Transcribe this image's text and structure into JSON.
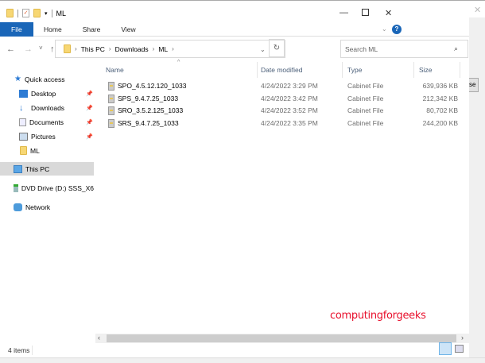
{
  "window": {
    "title": "ML",
    "minimize": "—",
    "maximize": "☐",
    "close": "✕"
  },
  "ribbon": {
    "tabs": [
      "File",
      "Home",
      "Share",
      "View"
    ],
    "help": "?",
    "expand": "⌄"
  },
  "nav": {
    "back": "←",
    "forward": "→",
    "recent": "˅",
    "up": "↑"
  },
  "address": {
    "crumbs": [
      "This PC",
      "Downloads",
      "ML"
    ],
    "sep": "›",
    "dropdown": "⌄",
    "refresh": "↻"
  },
  "search": {
    "placeholder": "Search ML",
    "icon": "⌕"
  },
  "sidebar": {
    "items": [
      {
        "label": "Quick access",
        "icon": "star-icon"
      },
      {
        "label": "Desktop",
        "icon": "desktop-icon",
        "pinned": true
      },
      {
        "label": "Downloads",
        "icon": "download-icon",
        "pinned": true
      },
      {
        "label": "Documents",
        "icon": "documents-icon",
        "pinned": true
      },
      {
        "label": "Pictures",
        "icon": "pictures-icon",
        "pinned": true
      },
      {
        "label": "ML",
        "icon": "folder-icon"
      },
      {
        "label": "This PC",
        "icon": "computer-icon",
        "selected": true
      },
      {
        "label": "DVD Drive (D:) SSS_X6",
        "icon": "dvd-icon"
      },
      {
        "label": "Network",
        "icon": "network-icon"
      }
    ]
  },
  "columns": [
    "Name",
    "Date modified",
    "Type",
    "Size"
  ],
  "files": [
    {
      "name": "SPO_4.5.12.120_1033",
      "date": "4/24/2022 3:29 PM",
      "type": "Cabinet File",
      "size": "639,936 KB"
    },
    {
      "name": "SPS_9.4.7.25_1033",
      "date": "4/24/2022 3:42 PM",
      "type": "Cabinet File",
      "size": "212,342 KB"
    },
    {
      "name": "SRO_3.5.2.125_1033",
      "date": "4/24/2022 3:52 PM",
      "type": "Cabinet File",
      "size": "80,702 KB"
    },
    {
      "name": "SRS_9.4.7.25_1033",
      "date": "4/24/2022 3:35 PM",
      "type": "Cabinet File",
      "size": "244,200 KB"
    }
  ],
  "watermark": "computingforgeeks",
  "status": {
    "count": "4 items"
  },
  "background": {
    "button_fragment": "se",
    "close": "✕"
  },
  "colors": {
    "accent": "#1a66b8",
    "watermark": "#e8112d",
    "selected": "#d9d9d9"
  }
}
